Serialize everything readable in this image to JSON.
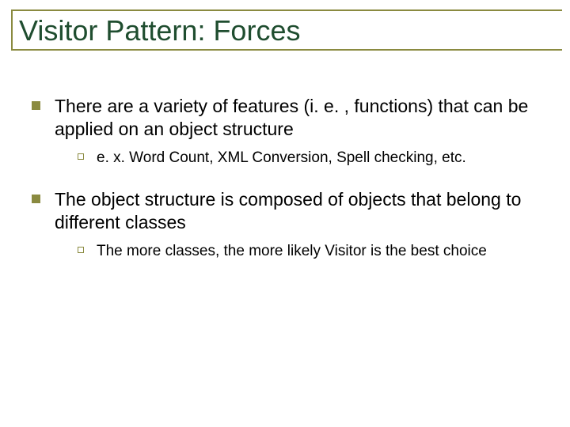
{
  "title": "Visitor Pattern: Forces",
  "bullets": [
    {
      "text": "There are a variety of features (i. e. , functions) that can be applied on an object structure",
      "sub": [
        {
          "text": "e. x. Word Count, XML Conversion, Spell checking, etc."
        }
      ]
    },
    {
      "text": "The object structure is composed of objects that belong to different classes",
      "sub": [
        {
          "text": "The more classes, the more likely Visitor is the best choice"
        }
      ]
    }
  ]
}
